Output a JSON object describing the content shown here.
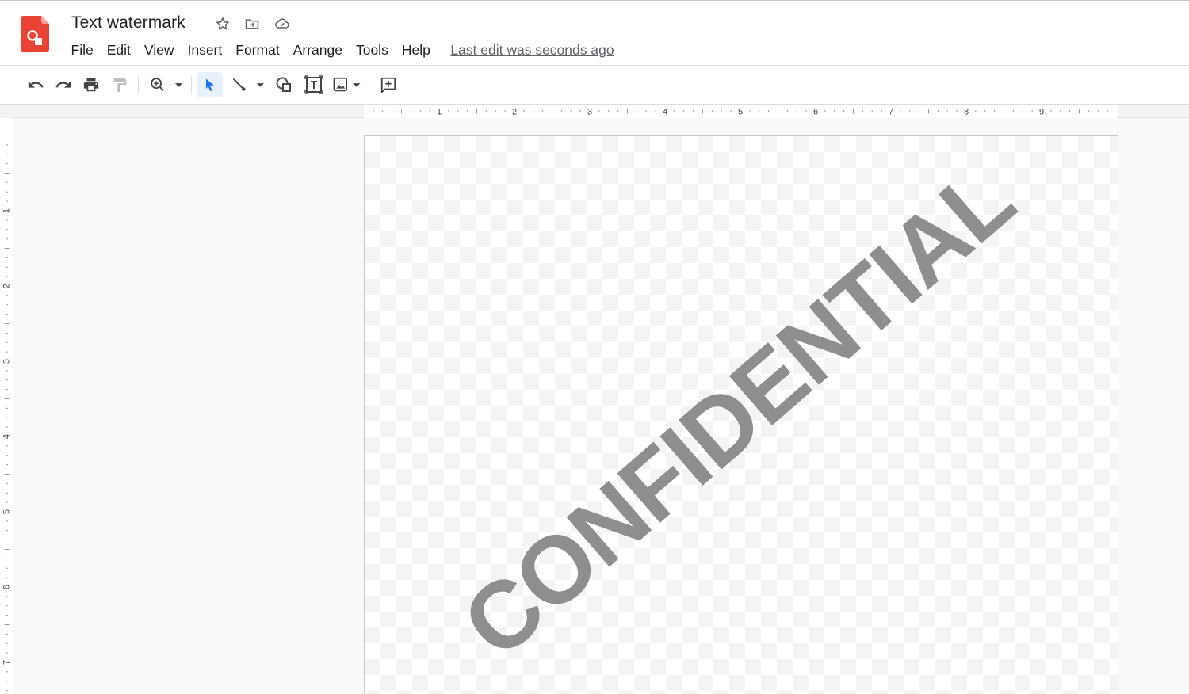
{
  "document": {
    "title": "Text watermark",
    "last_edit": "Last edit was seconds ago"
  },
  "menu": {
    "items": [
      {
        "label": "File"
      },
      {
        "label": "Edit"
      },
      {
        "label": "View"
      },
      {
        "label": "Insert"
      },
      {
        "label": "Format"
      },
      {
        "label": "Arrange"
      },
      {
        "label": "Tools"
      },
      {
        "label": "Help"
      }
    ]
  },
  "toolbar": {
    "icons": [
      "undo-icon",
      "redo-icon",
      "print-icon",
      "paint-format-icon",
      "zoom-icon",
      "select-icon",
      "line-icon",
      "shape-icon",
      "text-box-icon",
      "image-icon",
      "comment-icon"
    ],
    "active_tool": "select"
  },
  "rulers": {
    "horizontal_labels": [
      "1",
      "2",
      "3",
      "4",
      "5",
      "6",
      "7",
      "8",
      "9"
    ],
    "vertical_labels": [
      "1",
      "2",
      "3",
      "4",
      "5",
      "6",
      "7"
    ]
  },
  "slide": {
    "watermark_text": "CONFIDENTIAL"
  },
  "colors": {
    "brand_red": "#ea4335",
    "accent_blue": "#1a73e8",
    "watermark_gray": "#8e8e8e"
  }
}
